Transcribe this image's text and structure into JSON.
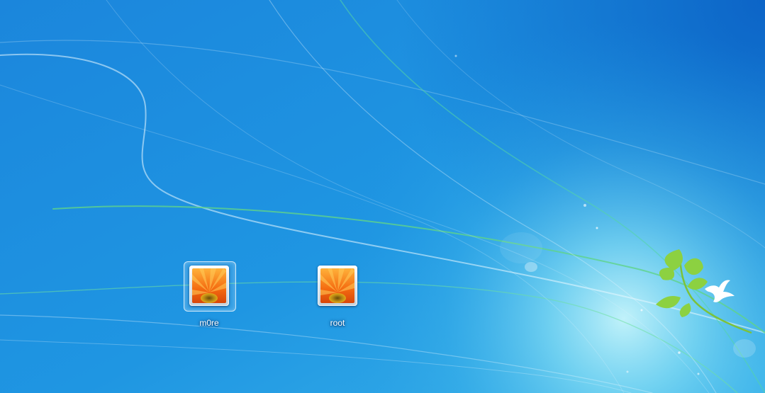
{
  "screen": "windows-logon-user-selection",
  "colors": {
    "background_top_left": "#0e6fcf",
    "background_glow": "#8fe6f6",
    "streak_green": "#5fd38a",
    "streak_white": "#e9f7ff",
    "label_text": "#ffffff",
    "leaf_green": "#8cd141",
    "bird_white": "#ffffff"
  },
  "wallpaper": {
    "elements": [
      "light-streaks",
      "green-sprig-icon",
      "white-bird-icon",
      "bokeh-dots"
    ]
  },
  "users": [
    {
      "name": "m0re",
      "avatar_icon": "orange-flower-avatar-icon",
      "selected": true
    },
    {
      "name": "root",
      "avatar_icon": "orange-flower-avatar-icon",
      "selected": false
    }
  ]
}
